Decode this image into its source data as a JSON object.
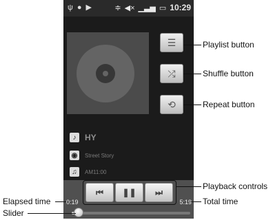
{
  "status_bar": {
    "time": "10:29",
    "icons": [
      "usb-icon",
      "android-icon",
      "play-icon",
      "signal-icon",
      "wifi-icon",
      "mute-icon",
      "battery-icon"
    ]
  },
  "player": {
    "artist": "HY",
    "album": "Street Story",
    "song": "AM11:00",
    "elapsed": "0:19",
    "total": "5:19",
    "progress_fraction": 0.06
  },
  "side_buttons": [
    {
      "name": "playlist-button",
      "icon": "playlist-icon",
      "glyph": "☰"
    },
    {
      "name": "shuffle-button",
      "icon": "shuffle-icon",
      "glyph": "⤮"
    },
    {
      "name": "repeat-button",
      "icon": "repeat-icon",
      "glyph": "⟲"
    }
  ],
  "controls": {
    "prev_glyph": "⏮",
    "play_pause_glyph": "❚❚",
    "next_glyph": "⏭"
  },
  "callouts": {
    "playlist": "Playlist button",
    "shuffle": "Shuffle button",
    "repeat": "Repeat button",
    "playback": "Playback controls",
    "total_time": "Total time",
    "elapsed_time": "Elapsed time",
    "slider": "Slider"
  }
}
